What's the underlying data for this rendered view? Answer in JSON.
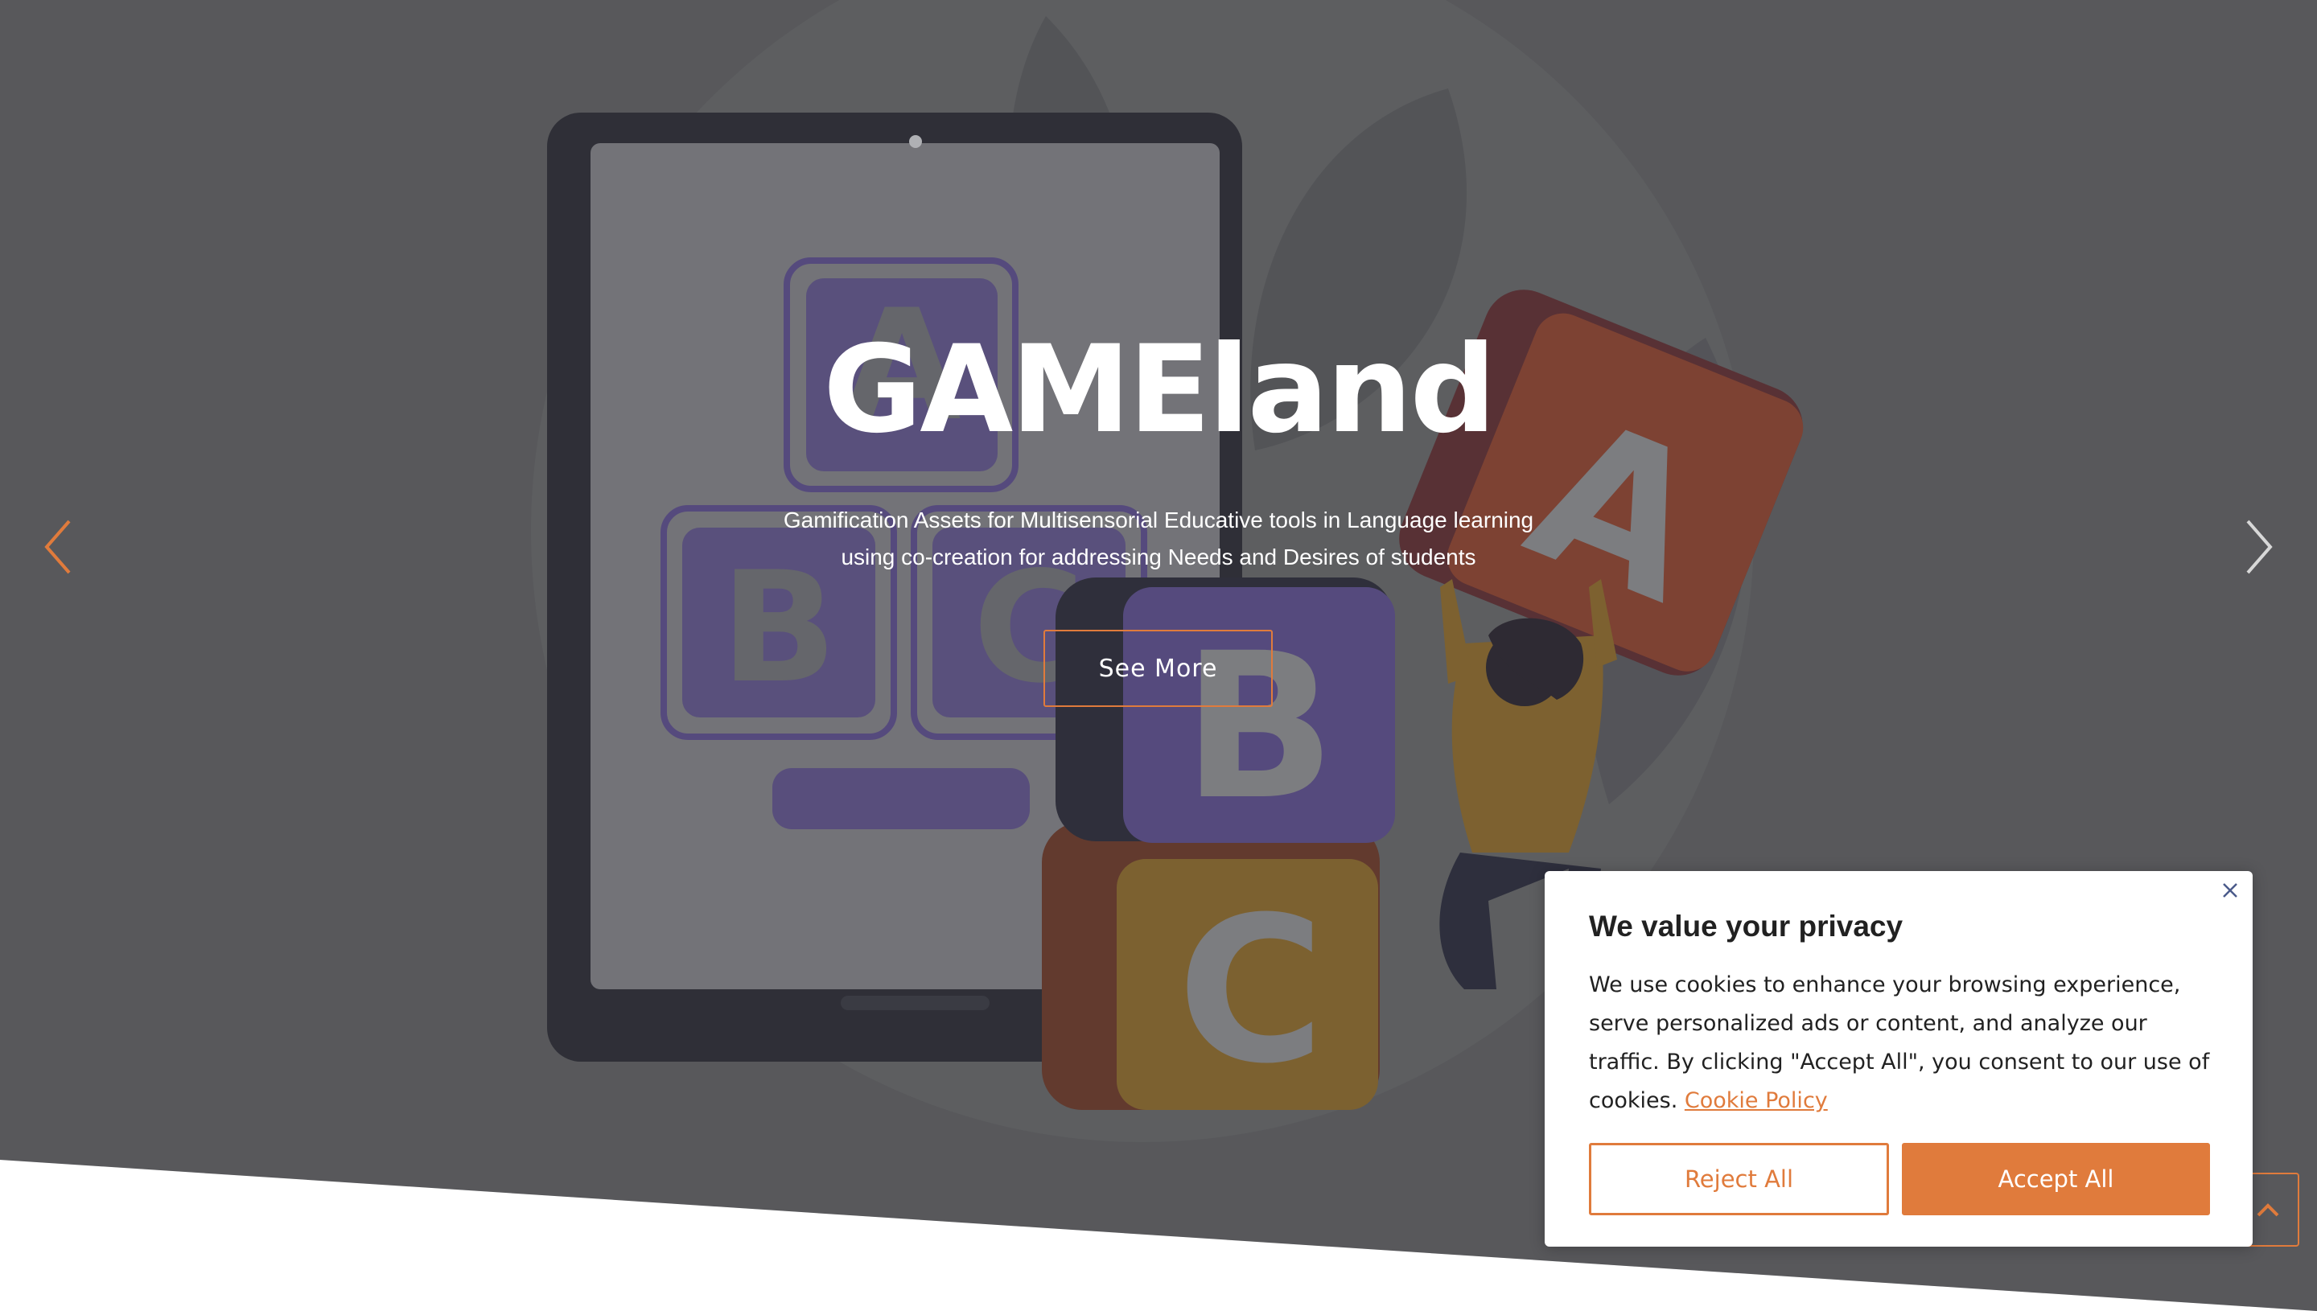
{
  "hero": {
    "title": "GAMEland",
    "subtitle_line1": "Gamification Assets for Multisensorial Educative tools in Language learning",
    "subtitle_line2": "using co-creation for addressing Needs and Desires of students",
    "cta_label": "See More",
    "prev_icon": "chevron-left-icon",
    "next_icon": "chevron-right-icon",
    "blocks": [
      "A",
      "B",
      "C"
    ],
    "tablet_blocks": [
      "A",
      "B",
      "C"
    ]
  },
  "cookie_banner": {
    "title": "We value your privacy",
    "body": "We use cookies to enhance your browsing experience, serve personalized ads or content, and analyze our traffic. By clicking \"Accept All\", you consent to our use of cookies. ",
    "link_label": "Cookie Policy",
    "reject_label": "Reject All",
    "accept_label": "Accept All",
    "close_icon": "close-icon"
  },
  "scroll_top_icon": "chevron-up-icon",
  "colors": {
    "accent": "#e07b3c",
    "hero_bg": "#5e5f61",
    "text_dark": "#212121"
  }
}
